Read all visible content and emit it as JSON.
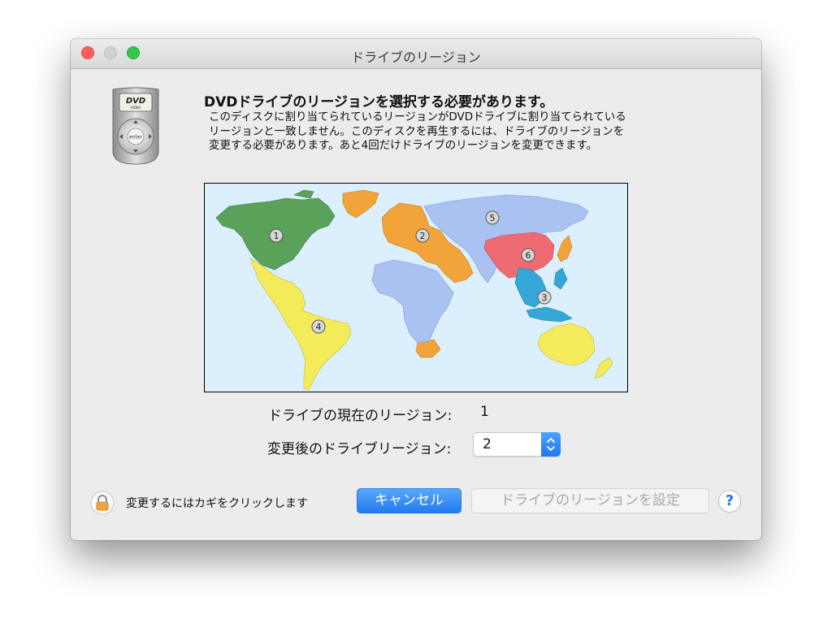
{
  "window": {
    "title": "ドライブのリージョン"
  },
  "header": {
    "heading": "DVDドライブのリージョンを選択する必要があります。",
    "body_lines": [
      "このディスクに割り当てられているリージョンがDVDドライブに割り当てられている",
      "リージョンと一致しません。このディスクを再生するには、ドライブのリージョンを",
      "変更する必要があります。あと4回だけドライブのリージョンを変更できます。"
    ]
  },
  "icon": {
    "dvd_text": "DVD",
    "video_text": "VIDEO",
    "enter_text": "enter"
  },
  "map": {
    "region_labels": [
      "1",
      "2",
      "3",
      "4",
      "5",
      "6"
    ],
    "colors": {
      "ocean": "#dbeffc",
      "region1": "#5aa15a",
      "region2": "#f2a43a",
      "region3": "#34a7d6",
      "region4": "#f4eb5a",
      "region5": "#a9c2f2",
      "region6": "#ef6b72"
    }
  },
  "region": {
    "current_label": "ドライブの現在のリージョン:",
    "current_value": "1",
    "new_label": "変更後のドライブリージョン:",
    "new_value": "2"
  },
  "footer": {
    "lock_text": "変更するにはカギをクリックします",
    "cancel_label": "キャンセル",
    "set_label": "ドライブのリージョンを設定",
    "help_label": "?"
  }
}
